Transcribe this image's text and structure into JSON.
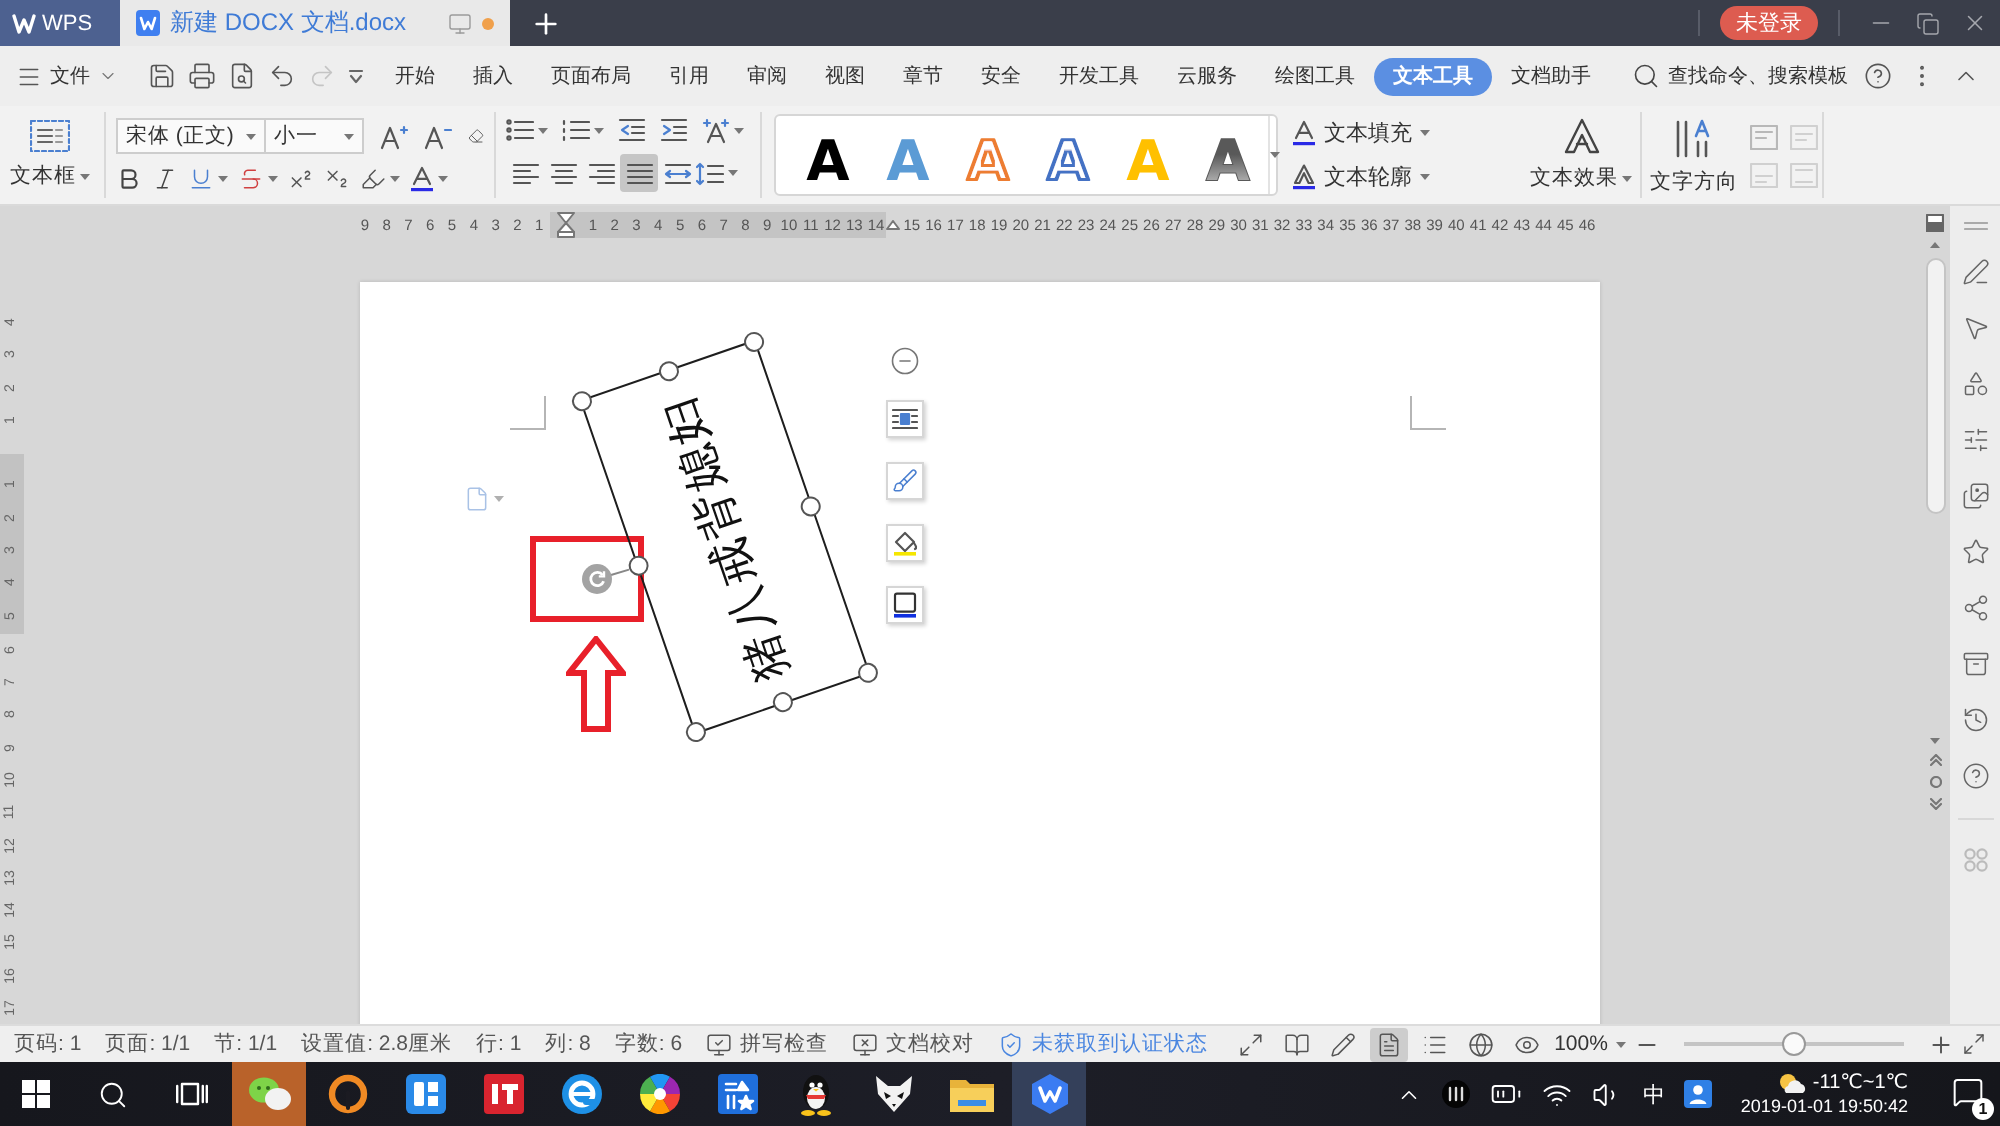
{
  "title_bar": {
    "app_name": "WPS",
    "document": {
      "title": "新建 DOCX 文档.docx",
      "unsaved": true
    },
    "account": "未登录"
  },
  "menu_bar": {
    "file": "文件",
    "tabs": [
      {
        "label": "开始",
        "selected": false
      },
      {
        "label": "插入",
        "selected": false
      },
      {
        "label": "页面布局",
        "selected": false
      },
      {
        "label": "引用",
        "selected": false
      },
      {
        "label": "审阅",
        "selected": false
      },
      {
        "label": "视图",
        "selected": false
      },
      {
        "label": "章节",
        "selected": false
      },
      {
        "label": "安全",
        "selected": false
      },
      {
        "label": "开发工具",
        "selected": false
      },
      {
        "label": "云服务",
        "selected": false
      },
      {
        "label": "绘图工具",
        "selected": false
      },
      {
        "label": "文本工具",
        "selected": true
      },
      {
        "label": "文档助手",
        "selected": false
      }
    ],
    "search": "查找命令、搜索模板"
  },
  "ribbon": {
    "text_box": "文本框",
    "font_name": "宋体 (正文)",
    "font_size": "小一",
    "alignment": [
      {
        "kind": "left",
        "selected": false
      },
      {
        "kind": "center",
        "selected": false
      },
      {
        "kind": "right",
        "selected": false
      },
      {
        "kind": "justify",
        "selected": true
      },
      {
        "kind": "distributed",
        "selected": false
      }
    ],
    "text_styles": [
      {
        "label": "A",
        "kind": "fill",
        "color": "#000000"
      },
      {
        "label": "A",
        "kind": "fill",
        "color": "#5b9bd5"
      },
      {
        "label": "A",
        "kind": "outline",
        "color": "#ed7d31"
      },
      {
        "label": "A",
        "kind": "outline",
        "color": "#4472c4"
      },
      {
        "label": "A",
        "kind": "fill",
        "color": "#ffc000"
      },
      {
        "label": "A",
        "kind": "gradient",
        "color": "#595959"
      }
    ],
    "text_fill": "文本填充",
    "text_outline": "文本轮廓",
    "text_effect": "文本效果",
    "text_direction": "文字方向"
  },
  "ruler": {
    "before": [
      "9",
      "8",
      "7",
      "6",
      "5",
      "4",
      "3",
      "2",
      "1"
    ],
    "after": [
      "1",
      "2",
      "3",
      "4",
      "5",
      "6",
      "7",
      "8",
      "9",
      "10",
      "11",
      "12",
      "13",
      "14",
      "15",
      "16",
      "17",
      "18",
      "19",
      "20",
      "21",
      "22",
      "23",
      "24",
      "25",
      "26",
      "27",
      "28",
      "29",
      "30",
      "31",
      "32",
      "33",
      "34",
      "35",
      "36",
      "37",
      "38",
      "39",
      "40",
      "41",
      "42",
      "43",
      "44",
      "45",
      "46"
    ]
  },
  "vertical_ruler": {
    "before": [
      "4",
      "3",
      "2",
      "1"
    ],
    "after": [
      "1",
      "2",
      "3",
      "4",
      "5",
      "6",
      "7",
      "8",
      "9",
      "10",
      "11",
      "12",
      "13",
      "14",
      "15",
      "16",
      "17"
    ]
  },
  "document": {
    "text_box": {
      "text": "猪八戒背媳妇"
    }
  },
  "status_bar": {
    "fields": [
      "页码: 1",
      "页面: 1/1",
      "节: 1/1",
      "设置值: 2.8厘米",
      "行: 1",
      "列: 8",
      "字数: 6"
    ],
    "spell_check": "拼写检查",
    "proofread": "文档校对",
    "certification": "未获取到认证状态",
    "view_modes": [
      {
        "kind": "fullscreen",
        "selected": false
      },
      {
        "kind": "reading",
        "selected": false
      },
      {
        "kind": "edit",
        "selected": false
      },
      {
        "kind": "page",
        "selected": true
      },
      {
        "kind": "outline",
        "selected": false
      },
      {
        "kind": "web",
        "selected": false
      },
      {
        "kind": "eye",
        "selected": false
      }
    ],
    "zoom": "100%",
    "zoom_slider": {
      "level": 0.5
    }
  },
  "taskbar": {
    "apps": [
      {
        "kind": "wechat",
        "highlighted": true,
        "active": false
      },
      {
        "kind": "ring",
        "highlighted": false,
        "active": false
      },
      {
        "kind": "blocks",
        "highlighted": false,
        "active": false
      },
      {
        "kind": "news",
        "highlighted": false,
        "active": false
      },
      {
        "kind": "ie",
        "highlighted": false,
        "active": false
      },
      {
        "kind": "wheel",
        "highlighted": false,
        "active": false
      },
      {
        "kind": "toolbox",
        "highlighted": false,
        "active": false
      },
      {
        "kind": "qq",
        "highlighted": false,
        "active": false
      },
      {
        "kind": "fox",
        "highlighted": false,
        "active": false
      },
      {
        "kind": "folder",
        "highlighted": false,
        "active": false
      },
      {
        "kind": "wps",
        "highlighted": false,
        "active": true
      }
    ],
    "tray": {
      "input_method": "中",
      "weather": "-11℃~1℃",
      "clock": "2019-01-01 19:50:42",
      "notifications": "1"
    }
  }
}
